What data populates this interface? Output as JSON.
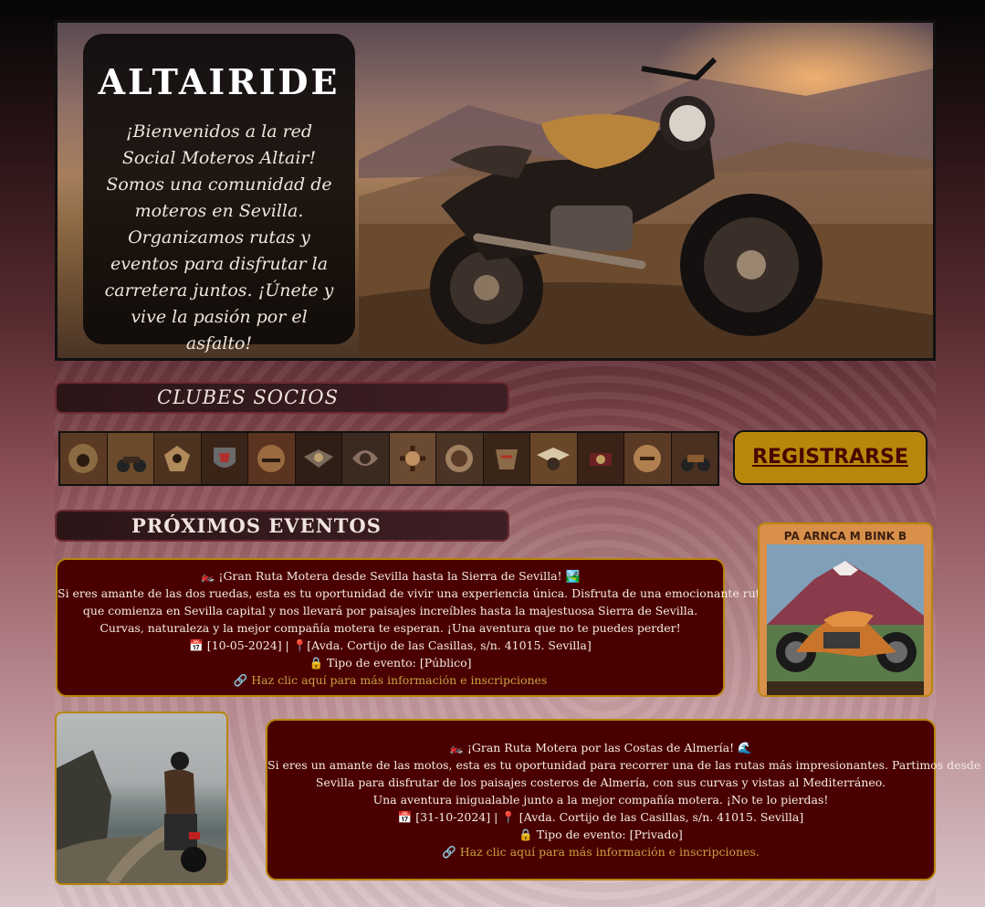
{
  "hero": {
    "title": "ALTAIRIDE",
    "text": "¡Bienvenidos a la red Social Moteros Altair! Somos una comunidad de moteros en Sevilla. Organizamos rutas y eventos para disfrutar la carretera juntos. ¡Únete y vive la pasión por el asfalto!"
  },
  "clubs": {
    "heading": "CLUBES SOCIOS",
    "logo_count_note": "club logos strip"
  },
  "register": {
    "label": "REGISTRARSE"
  },
  "events": {
    "heading": "PRÓXIMOS EVENTOS",
    "items": [
      {
        "title": "🏍️ ¡Gran Ruta Motera desde Sevilla hasta la Sierra de Sevilla! 🏞️",
        "desc1": "Si eres amante de las dos ruedas, esta es tu oportunidad de vivir una experiencia única. Disfruta de una emocionante ruta",
        "desc2": "que comienza en Sevilla capital y nos llevará por paisajes increíbles hasta la majestuosa Sierra de Sevilla.",
        "desc3": "Curvas, naturaleza y la mejor compañía motera te esperan. ¡Una aventura que no te puedes perder!",
        "when_where": "📅 [10-05-2024] | 📍[Avda. Cortijo de las Casillas, s/n. 41015. Sevilla]",
        "type": "🔒 Tipo de evento: [Público]",
        "link": "🔗 Haz clic aquí para más información e inscripciones"
      },
      {
        "title": "🏍️ ¡Gran Ruta Motera por las Costas de Almería! 🌊",
        "desc1": "Si eres un amante de las motos, esta es tu oportunidad para recorrer una de las rutas más impresionantes. Partimos desde",
        "desc2": "Sevilla para disfrutar de los paisajes costeros de Almería, con sus curvas y vistas al Mediterráneo.",
        "desc3": "Una aventura inigualable junto a la mejor compañía motera. ¡No te lo pierdas!",
        "when_where": "📅 [31-10-2024] | 📍 [Avda. Cortijo de las Casillas, s/n. 41015. Sevilla]",
        "type": "🔒 Tipo de evento: [Privado]",
        "link": "🔗 Haz clic aquí para más información e inscripciones."
      }
    ]
  },
  "poster": {
    "title": "PA ARNCA M BINK B"
  },
  "colors": {
    "card_bg": "#4a0000",
    "card_border": "#b8860b",
    "link": "#c9a040",
    "register_bg": "#b8860b",
    "register_text": "#4a0500"
  }
}
